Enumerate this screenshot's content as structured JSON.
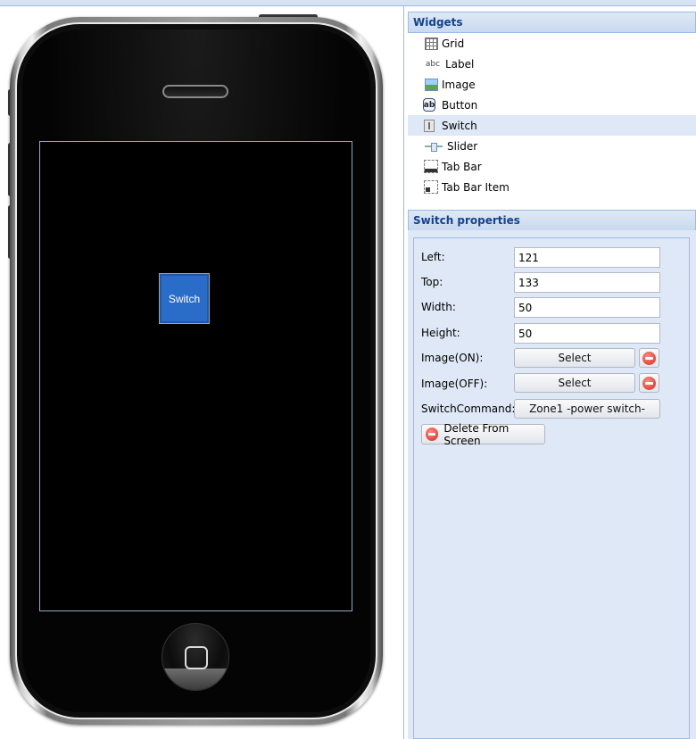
{
  "widgets_panel": {
    "title": "Widgets",
    "items": [
      {
        "label": "Grid",
        "icon": "grid-icon"
      },
      {
        "label": "Label",
        "icon": "label-icon",
        "icon_text": "abc"
      },
      {
        "label": "Image",
        "icon": "image-icon"
      },
      {
        "label": "Button",
        "icon": "button-icon",
        "icon_text": "ab"
      },
      {
        "label": "Switch",
        "icon": "switch-icon",
        "selected": true
      },
      {
        "label": "Slider",
        "icon": "slider-icon"
      },
      {
        "label": "Tab Bar",
        "icon": "tab-bar-icon"
      },
      {
        "label": "Tab Bar Item",
        "icon": "tab-bar-item-icon"
      }
    ]
  },
  "canvas": {
    "switch_label": "Switch"
  },
  "properties_panel": {
    "title": "Switch properties",
    "left_label": "Left:",
    "left_value": "121",
    "top_label": "Top:",
    "top_value": "133",
    "width_label": "Width:",
    "width_value": "50",
    "height_label": "Height:",
    "height_value": "50",
    "image_on_label": "Image(ON):",
    "image_on_button": "Select",
    "image_off_label": "Image(OFF):",
    "image_off_button": "Select",
    "command_label": "SwitchCommand:",
    "command_button": "Zone1 -power switch-",
    "delete_button": "Delete From Screen"
  },
  "colors": {
    "accent": "#15428b",
    "panel_border": "#99bbe8",
    "panel_bg": "#dfe8f6",
    "switch_fill": "#2a6dc9"
  }
}
